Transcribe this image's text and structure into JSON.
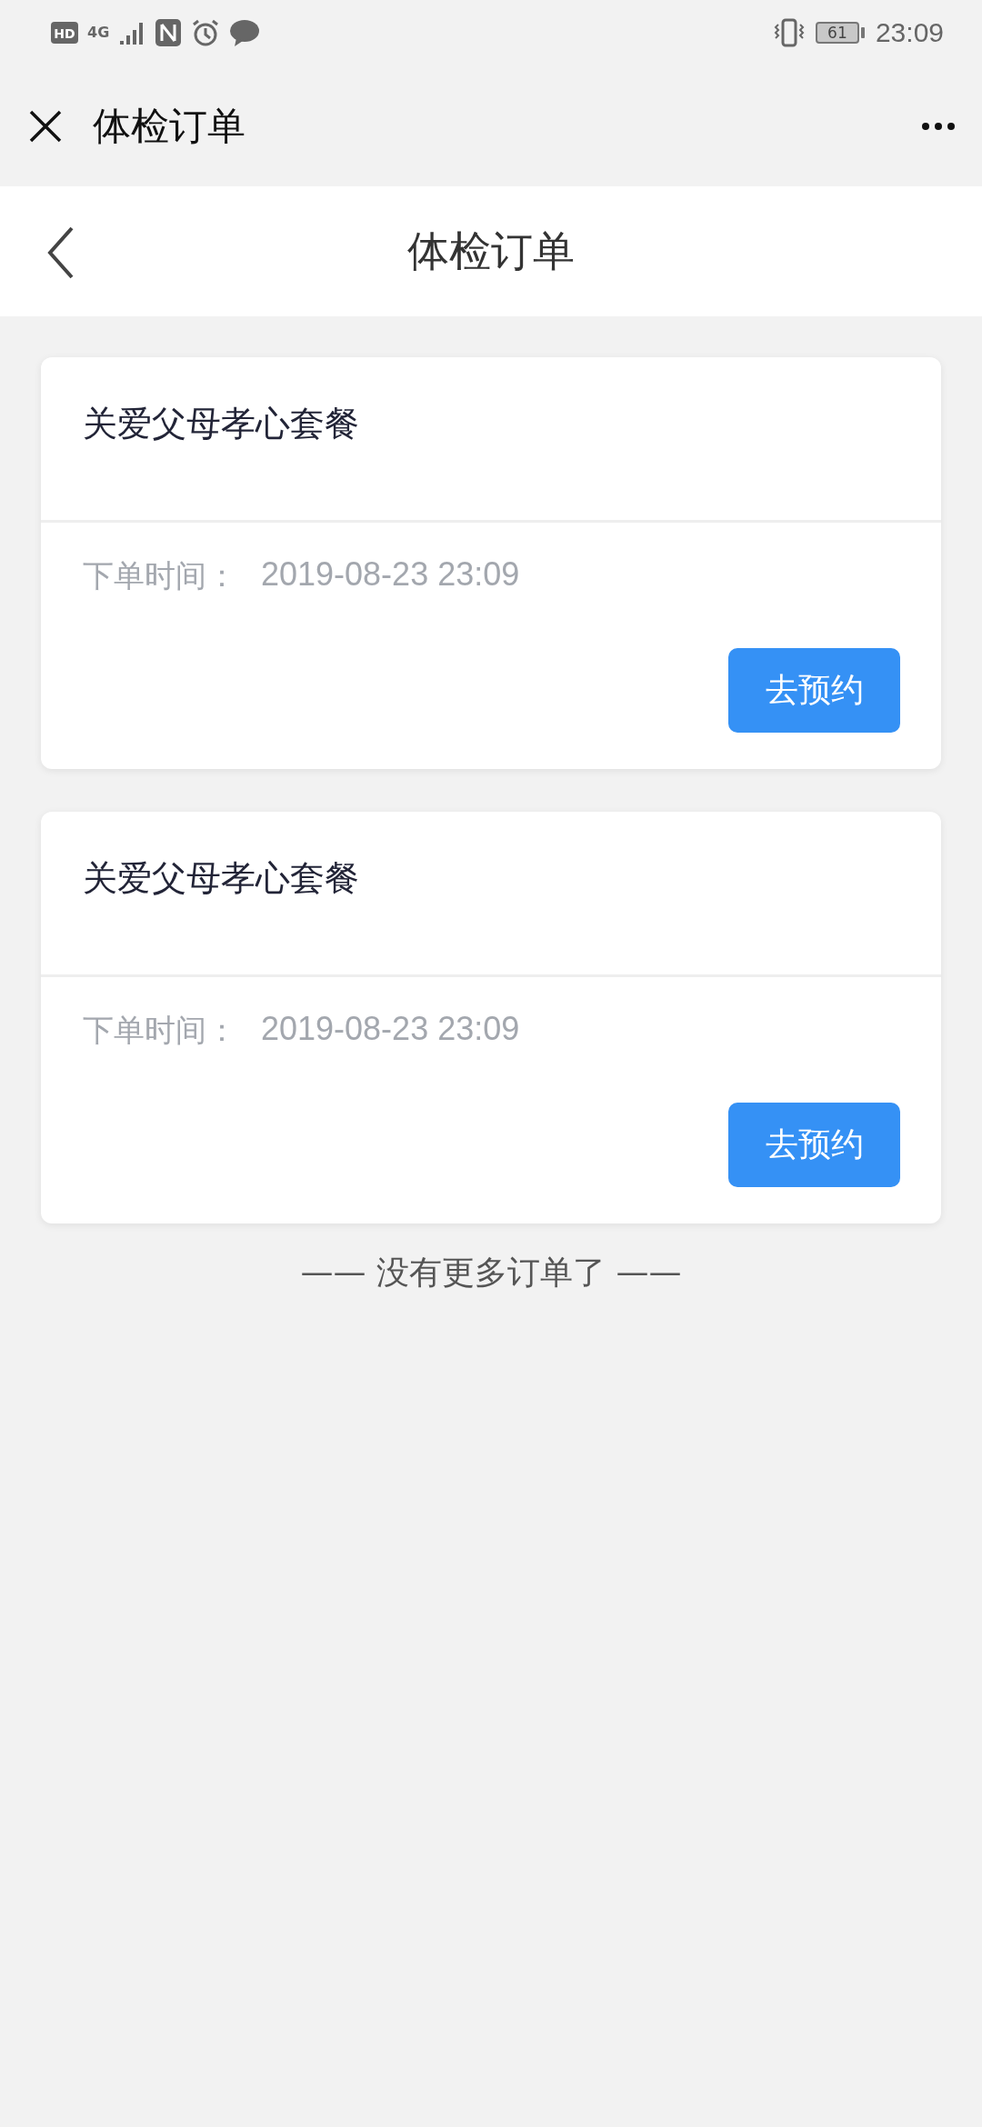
{
  "status_bar": {
    "hd": "HD",
    "network": "4G",
    "battery": "61",
    "time": "23:09"
  },
  "top_bar": {
    "title": "体检订单"
  },
  "header": {
    "title": "体检订单"
  },
  "orders": [
    {
      "name": "关爱父母孝心套餐",
      "time_label": "下单时间：",
      "time": "2019-08-23 23:09",
      "action": "去预约"
    },
    {
      "name": "关爱父母孝心套餐",
      "time_label": "下单时间：",
      "time": "2019-08-23 23:09",
      "action": "去预约"
    }
  ],
  "footer": "—— 没有更多订单了 ——"
}
